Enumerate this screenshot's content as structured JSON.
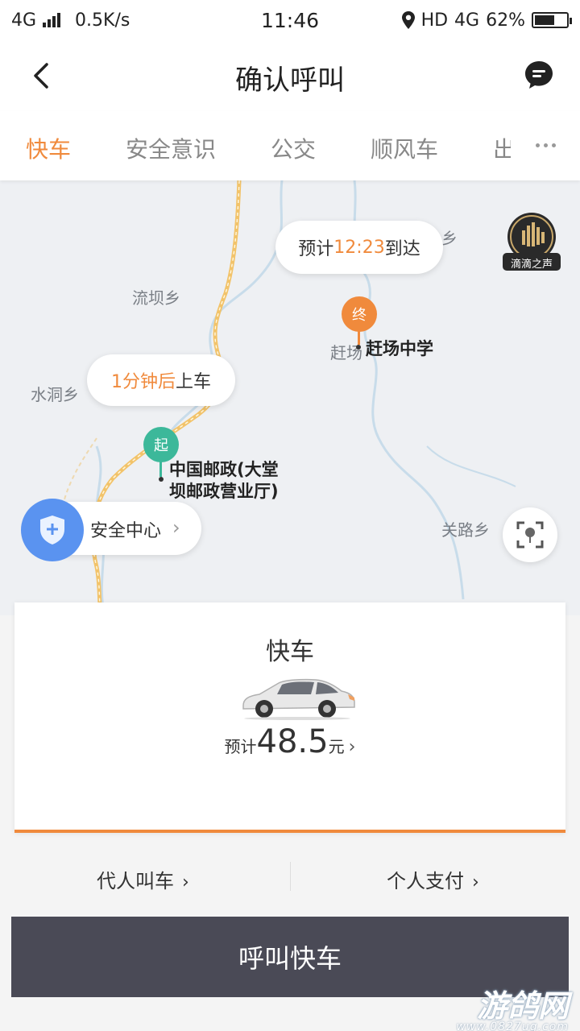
{
  "status_bar": {
    "network": "4G",
    "speed": "0.5K/s",
    "time": "11:46",
    "hd": "HD",
    "network_right": "4G",
    "battery": "62%",
    "battery_level": 0.62
  },
  "header": {
    "title": "确认呼叫",
    "back_icon": "chevron-left-icon",
    "message_icon": "message-icon"
  },
  "tabs": [
    {
      "label": "快车",
      "active": true
    },
    {
      "label": "安全意识",
      "active": false
    },
    {
      "label": "公交",
      "active": false
    },
    {
      "label": "顺风车",
      "active": false
    },
    {
      "label": "出",
      "active": false
    }
  ],
  "map": {
    "labels": [
      "流坝乡",
      "水洞乡",
      "关路乡",
      "乡",
      "赶场"
    ],
    "eta_bubble": {
      "prefix": "预计",
      "time": "12:23",
      "suffix": "到达"
    },
    "pickup_bubble": {
      "highlight": "1分钟后",
      "suffix": "上车"
    },
    "start_pin": "起",
    "end_pin": "终",
    "start_place_line1": "中国邮政(大堂",
    "start_place_line2": "坝邮政营业厅)",
    "end_place": "赶场中学",
    "safety_center": "安全中心",
    "voice_badge": "滴滴之声"
  },
  "card": {
    "car_type": "快车",
    "price_prefix": "预计",
    "price": "48.5",
    "price_unit": "元"
  },
  "options": {
    "proxy_call": "代人叫车",
    "payment": "个人支付"
  },
  "call_button": "呼叫快车",
  "watermark": {
    "big": "游鸽网",
    "small": "www.0827ug.com"
  },
  "colors": {
    "accent": "#f08a3c",
    "start_green": "#3cb89a",
    "button_dark": "#4a4a56",
    "safety_blue": "#5a93f0"
  }
}
